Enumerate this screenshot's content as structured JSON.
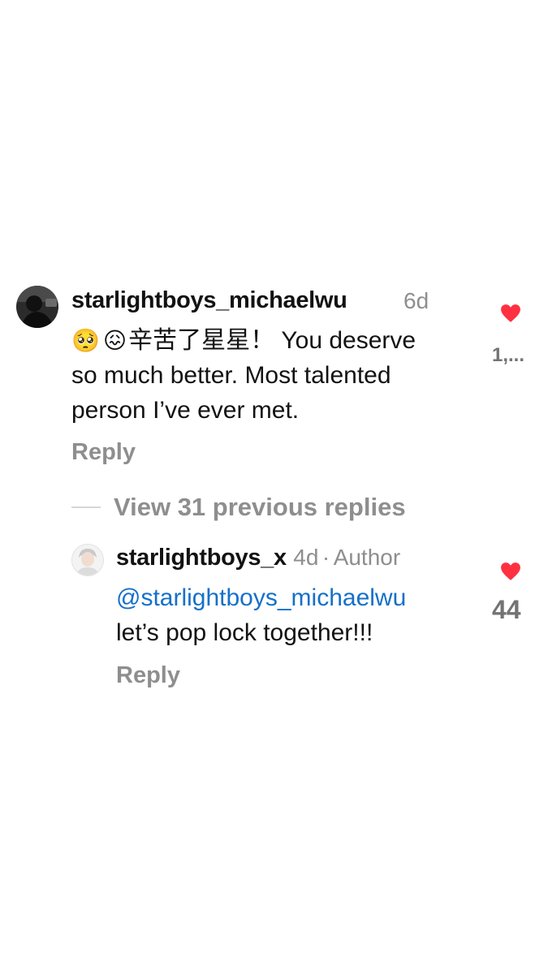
{
  "comment": {
    "username": "starlightboys_michaelwu",
    "time": "6d",
    "emoji": [
      "🥺",
      "😖"
    ],
    "text_line1": "辛苦了星星！ You deserve",
    "text_line2": "so much better. Most talented",
    "text_line3": "person I’ve ever met.",
    "reply_label": "Reply",
    "like_count": "1,..."
  },
  "view_replies_label": "View 31 previous replies",
  "reply": {
    "username": "starlightboys_x",
    "time": "4d",
    "separator": "·",
    "badge": "Author",
    "mention": "@starlightboys_michaelwu",
    "text": "let’s pop lock together!!!",
    "reply_label": "Reply",
    "like_count": "44"
  },
  "colors": {
    "heart": "#ff3040",
    "mention": "#1570c9",
    "muted": "#8e8e8e"
  }
}
